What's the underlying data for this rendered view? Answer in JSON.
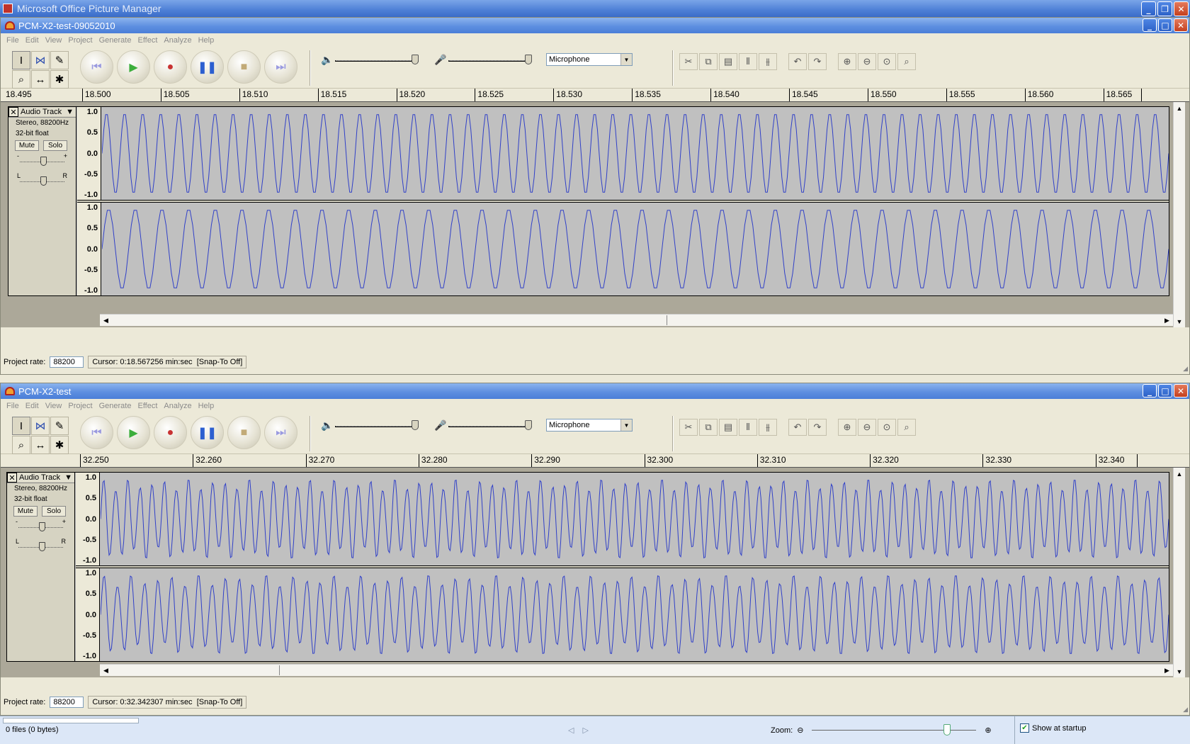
{
  "outer": {
    "title": "Microsoft Office Picture Manager",
    "buttons": {
      "min": "_",
      "restore": "❐",
      "close": "✕"
    }
  },
  "menu": [
    "File",
    "Edit",
    "View",
    "Project",
    "Generate",
    "Effect",
    "Analyze",
    "Help"
  ],
  "toolbar": {
    "input_source": "Microphone"
  },
  "track": {
    "name": "Audio Track",
    "format": "Stereo, 88200Hz",
    "depth": "32-bit float",
    "mute": "Mute",
    "solo": "Solo",
    "gain_minus": "-",
    "gain_plus": "+",
    "pan_left": "L",
    "pan_right": "R",
    "scale": [
      "1.0",
      "0.5",
      "0.0",
      "-0.5",
      "-1.0"
    ]
  },
  "windows": [
    {
      "title": "PCM-X2-test-09052010",
      "ruler": [
        "18.495",
        "18.500",
        "18.505",
        "18.510",
        "18.515",
        "18.520",
        "18.525",
        "18.530",
        "18.535",
        "18.540",
        "18.545",
        "18.550",
        "18.555",
        "18.560",
        "18.565"
      ],
      "project_rate_label": "Project rate:",
      "project_rate": "88200",
      "cursor": "Cursor: 0:18.567256 min:sec",
      "snap": "[Snap-To Off]",
      "hscroll_position": 0.53
    },
    {
      "title": "PCM-X2-test",
      "ruler": [
        "32.250",
        "32.260",
        "32.270",
        "32.280",
        "32.290",
        "32.300",
        "32.310",
        "32.320",
        "32.330",
        "32.340"
      ],
      "project_rate_label": "Project rate:",
      "project_rate": "88200",
      "cursor": "Cursor: 0:32.342307 min:sec",
      "snap": "[Snap-To Off]",
      "hscroll_position": 0.16
    }
  ],
  "pm_status": {
    "files": "0 files (0 bytes)",
    "zoom_label": "Zoom:",
    "zoom_level": 0.8,
    "show_at_startup": "Show at startup",
    "show_at_startup_checked": true
  }
}
